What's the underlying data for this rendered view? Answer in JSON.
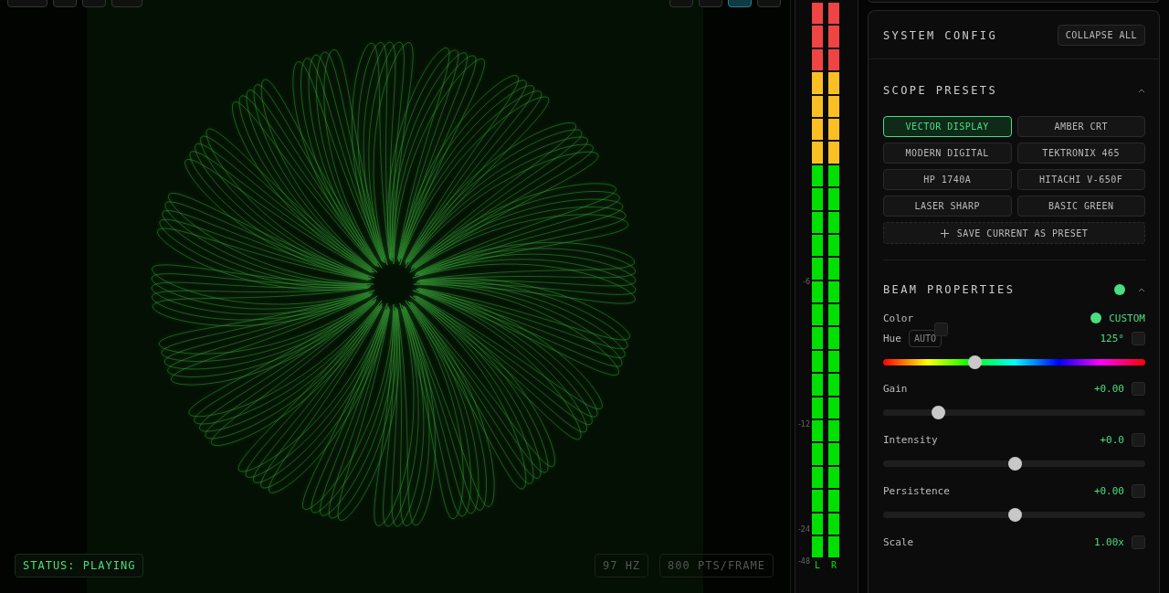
{
  "toolbar_left": [
    {
      "selected": false
    },
    {
      "selected": false
    },
    {
      "selected": false
    },
    {
      "selected": false
    }
  ],
  "toolbar_right": [
    {
      "selected": false
    },
    {
      "selected": false
    },
    {
      "selected": true
    },
    {
      "selected": false
    }
  ],
  "status": "STATUS: PLAYING",
  "frequency": "97 HZ",
  "points": "800 PTS/FRAME",
  "meter": {
    "ticks": [
      "-6",
      "-12",
      "-24",
      "-48"
    ],
    "channels": [
      {
        "label": "L"
      },
      {
        "label": "R"
      }
    ]
  },
  "panel": {
    "title": "SYSTEM CONFIG",
    "collapse_button": "COLLAPSE ALL",
    "presets": {
      "title": "SCOPE PRESETS",
      "expanded": true,
      "items": [
        {
          "label": "VECTOR DISPLAY",
          "selected": true
        },
        {
          "label": "AMBER CRT",
          "selected": false
        },
        {
          "label": "MODERN DIGITAL",
          "selected": false
        },
        {
          "label": "TEKTRONIX 465",
          "selected": false
        },
        {
          "label": "HP 1740A",
          "selected": false
        },
        {
          "label": "HITACHI V-650F",
          "selected": false
        },
        {
          "label": "LASER SHARP",
          "selected": false
        },
        {
          "label": "BASIC GREEN",
          "selected": false
        }
      ],
      "save_button": "SAVE CURRENT AS PRESET"
    },
    "beam": {
      "title": "BEAM PROPERTIES",
      "expanded": true,
      "color": "#4ade80",
      "color_label": "Color",
      "color_value": "CUSTOM",
      "hue": {
        "label": "Hue",
        "auto": "AUTO",
        "value": "125°",
        "level": 0.35
      },
      "sliders": [
        {
          "label": "Gain",
          "value": "+0.00",
          "level": 0.21
        },
        {
          "label": "Intensity",
          "value": "+0.0",
          "level": 0.5
        },
        {
          "label": "Persistence",
          "value": "+0.00",
          "level": 0.5
        },
        {
          "label": "Scale",
          "value": "1.00x"
        }
      ]
    }
  }
}
